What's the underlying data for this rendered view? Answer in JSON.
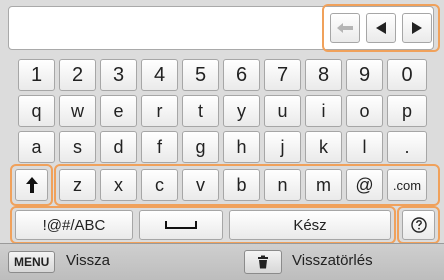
{
  "keyboard": {
    "row_numbers": [
      "1",
      "2",
      "3",
      "4",
      "5",
      "6",
      "7",
      "8",
      "9",
      "0"
    ],
    "row_q": [
      "q",
      "w",
      "e",
      "r",
      "t",
      "y",
      "u",
      "i",
      "o",
      "p"
    ],
    "row_a": [
      "a",
      "s",
      "d",
      "f",
      "g",
      "h",
      "j",
      "k",
      "l",
      "."
    ],
    "row_z": [
      "z",
      "x",
      "c",
      "v",
      "b",
      "n",
      "m",
      "@",
      ".com"
    ],
    "mode_label": "!@#/ABC",
    "done_label": "Kész"
  },
  "icons": {
    "shift": "up-arrow-icon",
    "space": "space-bar-icon",
    "help": "help-icon",
    "backspace": "backspace-icon",
    "left": "left-arrow-icon",
    "right": "right-arrow-icon",
    "trash": "trash-icon"
  },
  "footer": {
    "menu_badge": "MENU",
    "back_label": "Vissza",
    "delete_label": "Visszatörlés"
  },
  "colors": {
    "highlight": "#f0a15b",
    "background": "#dcdcdc"
  }
}
